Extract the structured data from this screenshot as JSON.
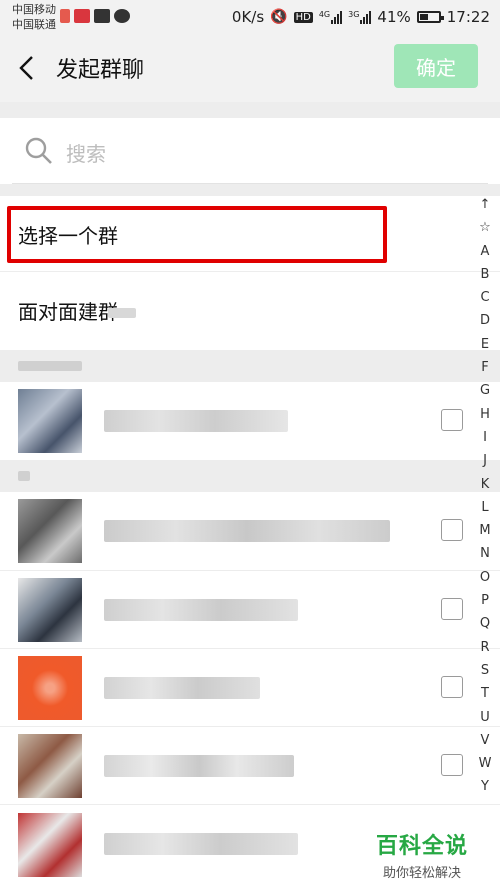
{
  "status_bar": {
    "carrier1": "中国移动",
    "carrier2": "中国联通",
    "speed": "0K/s",
    "hd": "HD",
    "net1": "4G",
    "net2": "3G",
    "battery": "41%",
    "time": "17:22"
  },
  "header": {
    "title": "发起群聊",
    "confirm_label": "确定"
  },
  "search": {
    "placeholder": "搜索"
  },
  "rows": {
    "select_group": "选择一个群",
    "face_to_face": "面对面建群"
  },
  "index_letters": [
    "↑",
    "☆",
    "A",
    "B",
    "C",
    "D",
    "E",
    "F",
    "G",
    "H",
    "I",
    "J",
    "K",
    "L",
    "M",
    "N",
    "O",
    "P",
    "Q",
    "R",
    "S",
    "T",
    "U",
    "V",
    "W",
    "Y"
  ],
  "watermark": {
    "title": "百科全说",
    "subtitle": "助你轻松解决"
  },
  "colors": {
    "accent_green": "#9fe6b7",
    "highlight_red": "#e00000",
    "watermark_green": "#27a844"
  },
  "icons": {
    "back": "back-arrow-icon",
    "search": "search-icon"
  }
}
